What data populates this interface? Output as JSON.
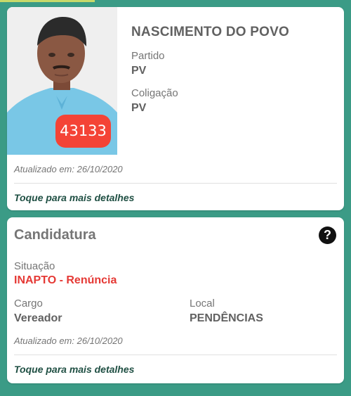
{
  "candidate": {
    "name": "NASCIMENTO DO POVO",
    "number": "43133",
    "party_label": "Partido",
    "party_value": "PV",
    "coalition_label": "Coligação",
    "coalition_value": "PV",
    "updated": "Atualizado em: 26/10/2020",
    "details_link": "Toque para mais detalhes"
  },
  "candidacy": {
    "title": "Candidatura",
    "help_icon": "?",
    "status_label": "Situação",
    "status_value": "INAPTO - Renúncia",
    "office_label": "Cargo",
    "office_value": "Vereador",
    "location_label": "Local",
    "location_value": "PENDÊNCIAS",
    "updated": "Atualizado em: 26/10/2020",
    "details_link": "Toque para mais detalhes"
  },
  "colors": {
    "background": "#3b9b86",
    "badge": "#f44336",
    "status": "#e53935",
    "link": "#1f4f43"
  }
}
